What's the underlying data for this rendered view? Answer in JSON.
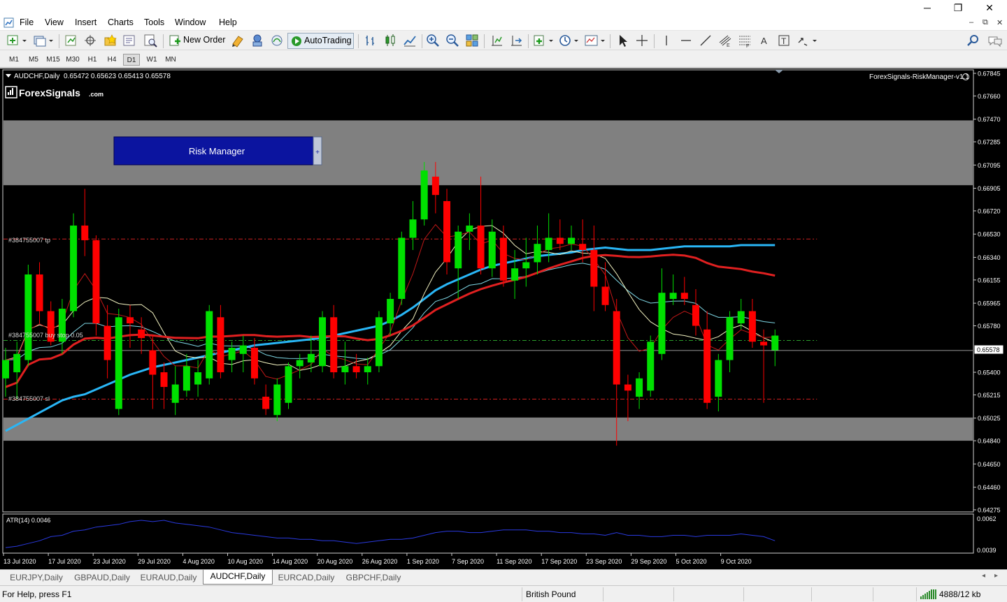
{
  "window": {
    "minimize": "─",
    "restore": "❐",
    "close": "✕"
  },
  "menu": [
    "File",
    "View",
    "Insert",
    "Charts",
    "Tools",
    "Window",
    "Help"
  ],
  "mdi_controls": [
    "–",
    "⧉",
    "✕"
  ],
  "toolbar": {
    "new_order": "New Order",
    "autotrading": "AutoTrading"
  },
  "timeframes": [
    "M1",
    "M5",
    "M15",
    "M30",
    "H1",
    "H4",
    "D1",
    "W1",
    "MN"
  ],
  "active_timeframe": "D1",
  "chart": {
    "symbol_header": "AUDCHF,Daily",
    "ohlc": "0.65472 0.65623 0.65413 0.65578",
    "brand": "ForexSignals",
    "brand_suffix": ".com",
    "indicator_name": "ForexSignals-RiskManager-v1.1",
    "risk_manager_button": "Risk Manager",
    "risk_manager_toggle": "+",
    "tp_label": "#384755007 tp",
    "entry_label": "#384755007 buy stop 0.05",
    "sl_label": "#384755007 sl",
    "current_price": "0.65578",
    "price_labels": [
      "0.67845",
      "0.67660",
      "0.67470",
      "0.67285",
      "0.67095",
      "0.66905",
      "0.66720",
      "0.66530",
      "0.66340",
      "0.66155",
      "0.65965",
      "0.65780",
      "0.65590",
      "0.65400",
      "0.65215",
      "0.65025",
      "0.64840",
      "0.64650",
      "0.64460",
      "0.64275"
    ],
    "atr_label": "ATR(14) 0.0046",
    "atr_high": "0.0062",
    "atr_low": "0.0039",
    "date_labels": [
      "13 Jul 2020",
      "17 Jul 2020",
      "23 Jul 2020",
      "29 Jul 2020",
      "4 Aug 2020",
      "10 Aug 2020",
      "14 Aug 2020",
      "20 Aug 2020",
      "26 Aug 2020",
      "1 Sep 2020",
      "7 Sep 2020",
      "11 Sep 2020",
      "17 Sep 2020",
      "23 Sep 2020",
      "29 Sep 2020",
      "5 Oct 2020",
      "9 Oct 2020"
    ],
    "colors": {
      "bull": "#00e000",
      "bear": "#ff0000",
      "sma_long": "#29b6f6",
      "sma_mid": "#e02020",
      "zone": "#808080"
    }
  },
  "chart_data": {
    "type": "candlestick",
    "symbol": "AUDCHF",
    "timeframe": "Daily",
    "ylim": [
      0.64275,
      0.67845
    ],
    "levels": {
      "tp": 0.6649,
      "entry": 0.6566,
      "sl": 0.6518,
      "current": 0.65578
    },
    "zones": [
      [
        0.6693,
        0.6746
      ],
      [
        0.6484,
        0.6503
      ]
    ],
    "candles": [
      [
        0.6535,
        0.656,
        0.652,
        0.655
      ],
      [
        0.654,
        0.6565,
        0.6518,
        0.6555
      ],
      [
        0.655,
        0.6628,
        0.6545,
        0.662
      ],
      [
        0.662,
        0.663,
        0.658,
        0.659
      ],
      [
        0.659,
        0.6598,
        0.6562,
        0.6565
      ],
      [
        0.6565,
        0.66,
        0.6555,
        0.6592
      ],
      [
        0.659,
        0.667,
        0.6585,
        0.666
      ],
      [
        0.666,
        0.669,
        0.6635,
        0.6648
      ],
      [
        0.6648,
        0.6652,
        0.657,
        0.658
      ],
      [
        0.6578,
        0.6595,
        0.6535,
        0.655
      ],
      [
        0.651,
        0.6592,
        0.6505,
        0.6585
      ],
      [
        0.6585,
        0.6595,
        0.656,
        0.658
      ],
      [
        0.6575,
        0.6585,
        0.6555,
        0.6568
      ],
      [
        0.6558,
        0.657,
        0.651,
        0.6538
      ],
      [
        0.654,
        0.6548,
        0.651,
        0.6528
      ],
      [
        0.6515,
        0.6545,
        0.6505,
        0.653
      ],
      [
        0.6525,
        0.6555,
        0.652,
        0.6545
      ],
      [
        0.653,
        0.655,
        0.652,
        0.654
      ],
      [
        0.6535,
        0.6595,
        0.653,
        0.659
      ],
      [
        0.6585,
        0.6595,
        0.6535,
        0.654
      ],
      [
        0.655,
        0.6565,
        0.654,
        0.656
      ],
      [
        0.6555,
        0.657,
        0.654,
        0.6562
      ],
      [
        0.656,
        0.6568,
        0.653,
        0.6535
      ],
      [
        0.652,
        0.653,
        0.6505,
        0.651
      ],
      [
        0.6505,
        0.6535,
        0.65,
        0.653
      ],
      [
        0.6515,
        0.6548,
        0.651,
        0.6545
      ],
      [
        0.6545,
        0.6555,
        0.6535,
        0.655
      ],
      [
        0.6548,
        0.657,
        0.654,
        0.6555
      ],
      [
        0.6545,
        0.659,
        0.654,
        0.6585
      ],
      [
        0.6585,
        0.6595,
        0.6535,
        0.654
      ],
      [
        0.654,
        0.6565,
        0.653,
        0.6545
      ],
      [
        0.6545,
        0.6555,
        0.6535,
        0.654
      ],
      [
        0.654,
        0.6552,
        0.653,
        0.6545
      ],
      [
        0.6545,
        0.659,
        0.654,
        0.6585
      ],
      [
        0.658,
        0.6605,
        0.657,
        0.66
      ],
      [
        0.66,
        0.6655,
        0.6595,
        0.665
      ],
      [
        0.665,
        0.668,
        0.664,
        0.6665
      ],
      [
        0.6665,
        0.6712,
        0.666,
        0.6705
      ],
      [
        0.67,
        0.6712,
        0.667,
        0.6685
      ],
      [
        0.668,
        0.669,
        0.662,
        0.663
      ],
      [
        0.6625,
        0.666,
        0.66,
        0.6655
      ],
      [
        0.6655,
        0.667,
        0.664,
        0.666
      ],
      [
        0.666,
        0.67,
        0.662,
        0.6625
      ],
      [
        0.6625,
        0.6665,
        0.6618,
        0.6655
      ],
      [
        0.665,
        0.666,
        0.661,
        0.6615
      ],
      [
        0.6615,
        0.664,
        0.66,
        0.6625
      ],
      [
        0.6625,
        0.665,
        0.661,
        0.663
      ],
      [
        0.663,
        0.666,
        0.662,
        0.6645
      ],
      [
        0.664,
        0.667,
        0.663,
        0.665
      ],
      [
        0.665,
        0.6665,
        0.664,
        0.6645
      ],
      [
        0.6645,
        0.666,
        0.664,
        0.665
      ],
      [
        0.6645,
        0.6665,
        0.663,
        0.664
      ],
      [
        0.664,
        0.666,
        0.659,
        0.661
      ],
      [
        0.661,
        0.663,
        0.659,
        0.6595
      ],
      [
        0.659,
        0.66,
        0.648,
        0.653
      ],
      [
        0.653,
        0.6538,
        0.65,
        0.6525
      ],
      [
        0.652,
        0.654,
        0.651,
        0.6535
      ],
      [
        0.6525,
        0.657,
        0.652,
        0.6565
      ],
      [
        0.6555,
        0.6625,
        0.655,
        0.6605
      ],
      [
        0.66,
        0.662,
        0.6595,
        0.6605
      ],
      [
        0.6605,
        0.6618,
        0.6595,
        0.66
      ],
      [
        0.6595,
        0.6608,
        0.657,
        0.6578
      ],
      [
        0.6575,
        0.659,
        0.651,
        0.6515
      ],
      [
        0.652,
        0.6555,
        0.6508,
        0.655
      ],
      [
        0.655,
        0.659,
        0.654,
        0.6585
      ],
      [
        0.658,
        0.66,
        0.6575,
        0.659
      ],
      [
        0.659,
        0.66,
        0.656,
        0.6565
      ],
      [
        0.6565,
        0.6575,
        0.6515,
        0.6562
      ],
      [
        0.6558,
        0.6575,
        0.6545,
        0.657
      ]
    ],
    "sma_long": [
      0.6492,
      0.6497,
      0.6502,
      0.6507,
      0.6512,
      0.6517,
      0.652,
      0.6522,
      0.6526,
      0.653,
      0.6534,
      0.6538,
      0.6541,
      0.6544,
      0.6546,
      0.6548,
      0.655,
      0.6552,
      0.6554,
      0.6556,
      0.6558,
      0.656,
      0.6562,
      0.6563,
      0.6564,
      0.6565,
      0.6566,
      0.6567,
      0.6568,
      0.657,
      0.6572,
      0.6574,
      0.6576,
      0.6578,
      0.6582,
      0.6587,
      0.6593,
      0.66,
      0.6607,
      0.6612,
      0.6616,
      0.662,
      0.6624,
      0.6627,
      0.6629,
      0.6631,
      0.6633,
      0.6635,
      0.6636,
      0.6637,
      0.6638,
      0.664,
      0.6641,
      0.6642,
      0.6641,
      0.664,
      0.664,
      0.664,
      0.6641,
      0.6642,
      0.6643,
      0.6643,
      0.6643,
      0.6643,
      0.6643,
      0.6644,
      0.6644,
      0.6644,
      0.6644
    ],
    "atr": [
      0.0041,
      0.0042,
      0.0044,
      0.0046,
      0.0049,
      0.005,
      0.0053,
      0.0054,
      0.0056,
      0.0057,
      0.0058,
      0.006,
      0.0061,
      0.006,
      0.0061,
      0.0059,
      0.0058,
      0.0057,
      0.0056,
      0.0054,
      0.0052,
      0.0051,
      0.005,
      0.0049,
      0.0048,
      0.0048,
      0.0047,
      0.0047,
      0.0046,
      0.0046,
      0.0045,
      0.0044,
      0.0045,
      0.0046,
      0.0047,
      0.0047,
      0.0048,
      0.005,
      0.0052,
      0.0053,
      0.0053,
      0.0052,
      0.0052,
      0.0053,
      0.0054,
      0.0054,
      0.0054,
      0.0053,
      0.0053,
      0.0052,
      0.0052,
      0.0051,
      0.0051,
      0.005,
      0.0052,
      0.005,
      0.005,
      0.0049,
      0.0049,
      0.005,
      0.005,
      0.0049,
      0.005,
      0.005,
      0.005,
      0.0051,
      0.005,
      0.0049,
      0.0046
    ]
  },
  "tabs": [
    "EURJPY,Daily",
    "GBPAUD,Daily",
    "EURAUD,Daily",
    "AUDCHF,Daily",
    "EURCAD,Daily",
    "GBPCHF,Daily"
  ],
  "active_tab": "AUDCHF,Daily",
  "tab_arrows": [
    "◂",
    "▸"
  ],
  "status": {
    "help": "For Help, press F1",
    "profile": "British Pound",
    "traffic": "4888/12 kb"
  }
}
